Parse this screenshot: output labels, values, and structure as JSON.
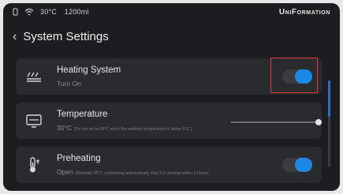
{
  "status_bar": {
    "temperature": "30°C",
    "volume": "1200ml",
    "brand": "UniFormation"
  },
  "page": {
    "title": "System Settings"
  },
  "settings": [
    {
      "title": "Heating System",
      "subtitle": "Turn On",
      "control": "toggle",
      "state": "on"
    },
    {
      "title": "Temperature",
      "value": "30°C",
      "note": "(Do not set to 30°C when the ambient temperature is below 5°C.)",
      "control": "slider"
    },
    {
      "title": "Preheating",
      "value": "Open",
      "note": "(Maintain 30°C, preheating automatically stop 3 hr printing within 3 hours)",
      "control": "toggle",
      "state": "on"
    }
  ],
  "icons": {
    "heating": "heating-lines-icon",
    "temperature": "monitor-icon",
    "preheating": "thermometer-icon"
  },
  "colors": {
    "accent": "#1e88e5",
    "highlight": "#e33b3b",
    "background": "#1c1d20",
    "card": "#2a2b2f"
  }
}
